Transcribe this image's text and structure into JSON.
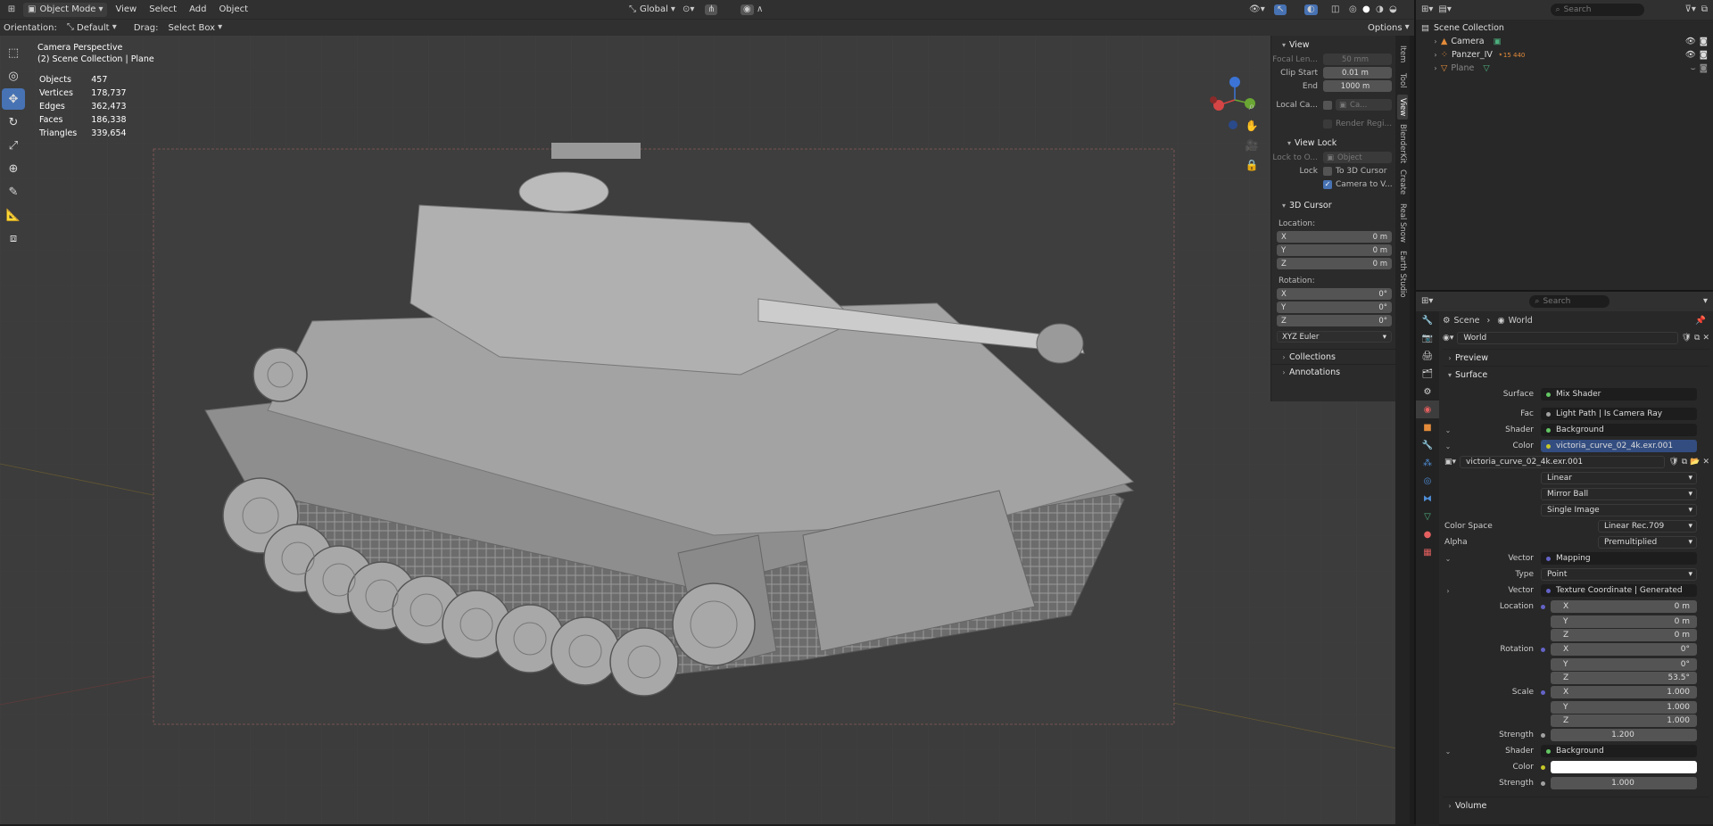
{
  "header": {
    "mode": "Object Mode",
    "menus": [
      "View",
      "Select",
      "Add",
      "Object"
    ],
    "transform": "Global",
    "search_placeholder": "Search"
  },
  "subheader": {
    "orientation_label": "Orientation:",
    "orientation_value": "Default",
    "drag_label": "Drag:",
    "drag_value": "Select Box",
    "options": "Options"
  },
  "viewport": {
    "title": "Camera Perspective",
    "collection": "(2) Scene Collection | Plane",
    "stats": [
      {
        "label": "Objects",
        "value": "457"
      },
      {
        "label": "Vertices",
        "value": "178,737"
      },
      {
        "label": "Edges",
        "value": "362,473"
      },
      {
        "label": "Faces",
        "value": "186,338"
      },
      {
        "label": "Triangles",
        "value": "339,654"
      }
    ]
  },
  "npanel": {
    "view_title": "View",
    "focal_label": "Focal Len...",
    "focal_value": "50 mm",
    "clip_start_label": "Clip Start",
    "clip_start_value": "0.01 m",
    "end_label": "End",
    "end_value": "1000 m",
    "local_cam_label": "Local Ca...",
    "local_cam_value": "Ca...",
    "render_region": "Render Regi...",
    "view_lock_title": "View Lock",
    "lock_to_label": "Lock to O...",
    "lock_to_value": "Object",
    "lock_label": "Lock",
    "to_cursor": "To 3D Cursor",
    "camera_to_view": "Camera to V...",
    "cursor_title": "3D Cursor",
    "location_label": "Location:",
    "loc": [
      {
        "axis": "X",
        "value": "0 m"
      },
      {
        "axis": "Y",
        "value": "0 m"
      },
      {
        "axis": "Z",
        "value": "0 m"
      }
    ],
    "rotation_label": "Rotation:",
    "rot": [
      {
        "axis": "X",
        "value": "0°"
      },
      {
        "axis": "Y",
        "value": "0°"
      },
      {
        "axis": "Z",
        "value": "0°"
      }
    ],
    "rot_mode": "XYZ Euler",
    "collections": "Collections",
    "annotations": "Annotations"
  },
  "side_tabs": [
    "Item",
    "Tool",
    "View",
    "BlenderKit",
    "Create",
    "Real Snow",
    "Earth Studio"
  ],
  "outliner": {
    "search_placeholder": "Search",
    "root": "Scene Collection",
    "items": [
      {
        "name": "Camera",
        "color": "#e38b3a"
      },
      {
        "name": "Panzer_IV",
        "color": "#e38b3a",
        "count": "15 440"
      },
      {
        "name": "Plane",
        "color": "#e38b3a"
      }
    ]
  },
  "properties": {
    "search_placeholder": "Search",
    "breadcrumb_scene": "Scene",
    "breadcrumb_world": "World",
    "world_name": "World",
    "preview": "Preview",
    "surface": "Surface",
    "volume": "Volume",
    "rows": {
      "surface_label": "Surface",
      "surface_value": "Mix Shader",
      "fac_label": "Fac",
      "fac_value": "Light Path | Is Camera Ray",
      "shader_label": "Shader",
      "shader_value": "Background",
      "color_label": "Color",
      "color_value": "victoria_curve_02_4k.exr.001",
      "image_name": "victoria_curve_02_4k.exr.001",
      "interp": "Linear",
      "proj": "Mirror Ball",
      "source": "Single Image",
      "colorspace_label": "Color Space",
      "colorspace_value": "Linear Rec.709",
      "alpha_label": "Alpha",
      "alpha_value": "Premultiplied",
      "vector_label": "Vector",
      "vector_value": "Mapping",
      "type_label": "Type",
      "type_value": "Point",
      "vector2_value": "Texture Coordinate | Generated",
      "location_label": "Location",
      "rotation_label": "Rotation",
      "scale_label": "Scale",
      "loc": [
        {
          "axis": "X",
          "value": "0 m"
        },
        {
          "axis": "Y",
          "value": "0 m"
        },
        {
          "axis": "Z",
          "value": "0 m"
        }
      ],
      "rot": [
        {
          "axis": "X",
          "value": "0°"
        },
        {
          "axis": "Y",
          "value": "0°"
        },
        {
          "axis": "Z",
          "value": "53.5°"
        }
      ],
      "scale": [
        {
          "axis": "X",
          "value": "1.000"
        },
        {
          "axis": "Y",
          "value": "1.000"
        },
        {
          "axis": "Z",
          "value": "1.000"
        }
      ],
      "strength_label": "Strength",
      "strength_value": "1.200",
      "shader2_value": "Background",
      "color2_label": "Color",
      "strength2_value": "1.000"
    }
  },
  "colors": {
    "accent": "#4772b3",
    "socket_green": "#63c763",
    "socket_yellow": "#c7c729",
    "socket_purple": "#6363c7",
    "socket_gray": "#a1a1a1"
  }
}
